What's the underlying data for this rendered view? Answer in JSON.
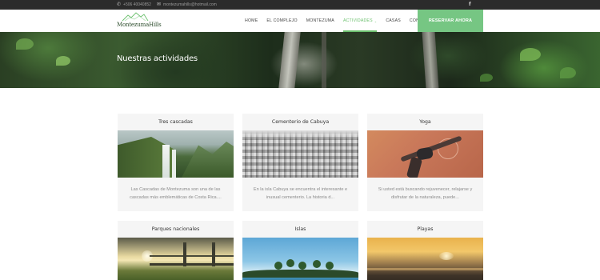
{
  "topbar": {
    "phone": "+506 40040852",
    "email": "montezumahills@hotmail.com",
    "social_icon": "facebook-icon",
    "social_glyph": "f"
  },
  "header": {
    "logo_text": "MontezumaHills",
    "nav": [
      {
        "label": "HOME",
        "active": false
      },
      {
        "label": "EL COMPLEJO",
        "active": false
      },
      {
        "label": "MONTEZUMA",
        "active": false
      },
      {
        "label": "ACTIVIDADES",
        "active": true,
        "has_dropdown": true
      },
      {
        "label": "CASAS",
        "active": false
      },
      {
        "label": "CONTACTO",
        "active": false
      }
    ],
    "cta_label": "RESERVAR AHORA"
  },
  "hero": {
    "title": "Nuestras actividades"
  },
  "activities": [
    {
      "title": "Tres cascadas",
      "description": "Las Cascadas de Montezuma son una de las cascadas más emblemáticas de Costa Rica...."
    },
    {
      "title": "Cementerio de Cabuya",
      "description": "En la isla Cabuya se encuentra el interesante e inusual cementerio. La historia d..."
    },
    {
      "title": "Yoga",
      "description": "Si usted está buscando rejuvenecer, relajarse y disfrutar de la naturaleza, puede..."
    },
    {
      "title": "Parques nacionales",
      "description": ""
    },
    {
      "title": "Islas",
      "description": ""
    },
    {
      "title": "Playas",
      "description": ""
    }
  ],
  "colors": {
    "accent": "#6cc06e",
    "cta_bg": "#76c683",
    "topbar_bg": "#2b2b2b",
    "card_bg": "#f5f5f5"
  }
}
